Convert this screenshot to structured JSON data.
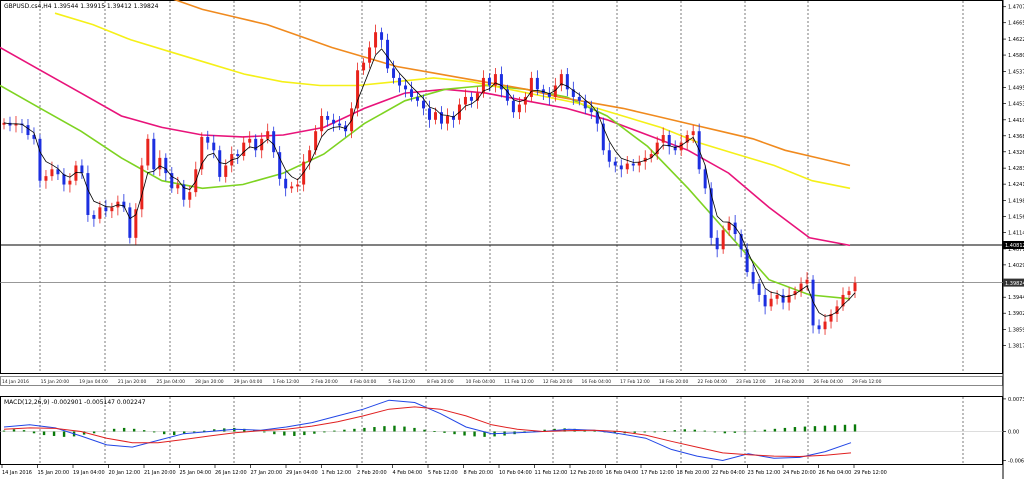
{
  "symbol_header": "GBPUSD.cs4,H4  1.39544 1.39915 1.39412 1.39824",
  "macd_header": "MACD(12,26,9) -0.002901 -0.005147 0.002247",
  "colors": {
    "bull": "#e8231c",
    "bear": "#1c2fe0",
    "ma_red": "#e8137a",
    "ma_green": "#7ed321",
    "ma_yellow": "#f5f018",
    "ma_orange": "#f08a1e",
    "ma_black": "#000000",
    "hist": "#0a7a0a",
    "macd_line": "#2246e6",
    "signal_line": "#e02020"
  },
  "chart_data": [
    {
      "type": "candlestick",
      "title": "GBPUSD.cs4,H4",
      "ylim": [
        1.3745,
        1.4722
      ],
      "price_labels": [
        "1.47070",
        "1.46650",
        "1.46220",
        "1.45800",
        "1.45370",
        "1.44950",
        "1.44530",
        "1.44100",
        "1.43680",
        "1.43260",
        "1.42830",
        "1.42410",
        "1.41980",
        "1.41560",
        "1.41140",
        "1.40710",
        "1.40290",
        "1.39440",
        "1.39020",
        "1.38590",
        "1.38170"
      ],
      "marked_prices": [
        "1.40812",
        "1.39824"
      ],
      "x_labels": [
        "14 Jan 2016",
        "15 Jan 20:00",
        "19 Jan 04:00",
        "20 Jan 12:00",
        "21 Jan 20:00",
        "25 Jan 04:00",
        "26 Jan 12:00",
        "27 Jan 20:00",
        "29 Jan 04:00",
        "1 Feb 12:00",
        "2 Feb 20:00",
        "4 Feb 04:00",
        "5 Feb 12:00",
        "8 Feb 20:00",
        "10 Feb 04:00",
        "11 Feb 12:00",
        "12 Feb 20:00",
        "16 Feb 04:00",
        "17 Feb 12:00",
        "18 Feb 20:00",
        "22 Feb 04:00",
        "23 Feb 12:00",
        "24 Feb 20:00",
        "26 Feb 04:00",
        "29 Feb 12:00"
      ],
      "mini_axis_labels": [
        "14 Jan 2016",
        "15 Jan 20:00",
        "19 Jan 04:00",
        "21 Jan 20:00",
        "25 Jan 04:00",
        "28 Jan 20:00",
        "29 Jan 04:00",
        "1 Feb 12:00",
        "2 Feb 20:00",
        "4 Feb 04:00",
        "5 Feb 12:00",
        "8 Feb 20:00",
        "10 Feb 04:00",
        "11 Feb 12:00",
        "12 Feb 20:00",
        "16 Feb 04:00",
        "17 Feb 12:00",
        "18 Feb 20:00",
        "22 Feb 04:00",
        "23 Feb 12:00",
        "24 Feb 20:00",
        "26 Feb 04:00",
        "29 Feb 12:00"
      ],
      "candles_close": [
        1.4402,
        1.4395,
        1.44,
        1.4396,
        1.437,
        1.436,
        1.425,
        1.4262,
        1.428,
        1.4267,
        1.424,
        1.425,
        1.429,
        1.427,
        1.416,
        1.415,
        1.418,
        1.417,
        1.418,
        1.4195,
        1.418,
        1.41,
        1.4175,
        1.429,
        1.436,
        1.428,
        1.431,
        1.427,
        1.423,
        1.424,
        1.42,
        1.422,
        1.428,
        1.4365,
        1.435,
        1.433,
        1.426,
        1.429,
        1.432,
        1.4315,
        1.435,
        1.436,
        1.433,
        1.436,
        1.438,
        1.4325,
        1.4255,
        1.423,
        1.4235,
        1.424,
        1.43,
        1.433,
        1.438,
        1.442,
        1.441,
        1.44,
        1.4395,
        1.438,
        1.444,
        1.454,
        1.456,
        1.46,
        1.464,
        1.462,
        1.4545,
        1.452,
        1.45,
        1.449,
        1.447,
        1.446,
        1.444,
        1.441,
        1.443,
        1.44,
        1.442,
        1.441,
        1.445,
        1.447,
        1.446,
        1.448,
        1.452,
        1.45,
        1.453,
        1.449,
        1.446,
        1.443,
        1.445,
        1.447,
        1.452,
        1.449,
        1.448,
        1.447,
        1.45,
        1.453,
        1.449,
        1.447,
        1.446,
        1.444,
        1.443,
        1.44,
        1.433,
        1.43,
        1.429,
        1.428,
        1.4295,
        1.429,
        1.43,
        1.431,
        1.432,
        1.435,
        1.437,
        1.434,
        1.433,
        1.435,
        1.437,
        1.438,
        1.428,
        1.423,
        1.41,
        1.407,
        1.412,
        1.414,
        1.411,
        1.407,
        1.401,
        1.398,
        1.395,
        1.392,
        1.394,
        1.395,
        1.393,
        1.395,
        1.396,
        1.398,
        1.399,
        1.387,
        1.386,
        1.388,
        1.39,
        1.392,
        1.395,
        1.396,
        1.3982
      ],
      "ma_series": [
        {
          "values": [
            1.46,
            1.454,
            1.448,
            1.442,
            1.439,
            1.437,
            1.4365,
            1.437,
            1.439,
            1.444,
            1.448,
            1.449,
            1.448,
            1.446,
            1.444,
            1.441,
            1.437,
            1.433,
            1.427,
            1.418,
            1.41,
            1.408
          ]
        },
        {
          "values": [
            1.45,
            1.444,
            1.438,
            1.431,
            1.425,
            1.423,
            1.424,
            1.427,
            1.432,
            1.44,
            1.446,
            1.449,
            1.45,
            1.449,
            1.447,
            1.442,
            1.434,
            1.423,
            1.411,
            1.399,
            1.395,
            1.394
          ]
        },
        {
          "values": [
            1.469,
            1.466,
            1.462,
            1.459,
            1.456,
            1.453,
            1.451,
            1.45,
            1.45,
            1.451,
            1.452,
            1.451,
            1.449,
            1.447,
            1.445,
            1.442,
            1.439,
            1.435,
            1.432,
            1.429,
            1.425,
            1.423
          ]
        },
        {
          "values": [
            1.473,
            1.47,
            1.468,
            1.466,
            1.463,
            1.46,
            1.4575,
            1.455,
            1.4535,
            1.452,
            1.4505,
            1.449,
            1.447,
            1.4455,
            1.444,
            1.442,
            1.44,
            1.438,
            1.436,
            1.433,
            1.431,
            1.429
          ]
        }
      ]
    },
    {
      "type": "histogram",
      "title": "MACD(12,26,9)",
      "ylim": [
        -0.0075,
        0.0075
      ],
      "y_labels": [
        "0.00730",
        "0.00",
        "-0.00647"
      ],
      "histogram": [
        0.0002,
        0.0005,
        0.0003,
        -0.0004,
        -0.0008,
        -0.001,
        -0.0012,
        -0.0011,
        -0.0007,
        -0.0004,
        0.0002,
        0.0006,
        0.0008,
        0.0006,
        0.0003,
        -0.0002,
        -0.0006,
        -0.0008,
        -0.0005,
        -0.0002,
        0.0002,
        0.0005,
        0.0007,
        0.0008,
        0.0006,
        0.0003,
        -0.0002,
        -0.0006,
        -0.0009,
        -0.001,
        -0.0008,
        -0.0005,
        -0.0002,
        0.0002,
        0.0004,
        0.0006,
        0.0008,
        0.001,
        0.0012,
        0.0013,
        0.0011,
        0.0008,
        0.0004,
        0.0001,
        -0.0003,
        -0.0006,
        -0.0009,
        -0.0011,
        -0.0012,
        -0.0011,
        -0.0009,
        -0.0006,
        -0.0003,
        0.0001,
        0.0004,
        0.0006,
        0.0007,
        0.0006,
        0.0004,
        0.0002,
        -0.0001,
        -0.0003,
        -0.0004,
        -0.0003,
        -0.0002,
        -0.0001,
        0.0001,
        0.0003,
        0.0005,
        0.0004,
        0.0002,
        -0.0002,
        -0.0004,
        -0.0003,
        -0.0001,
        0.0002,
        0.0004,
        0.0006,
        0.0008,
        0.001,
        0.0011,
        0.0012,
        0.0013,
        0.0014,
        0.0015,
        0.0016
      ],
      "macd": [
        0.001,
        0.0015,
        0.0008,
        -0.001,
        -0.003,
        -0.0035,
        -0.002,
        -0.0005,
        0.0,
        0.0005,
        0.0003,
        0.001,
        0.002,
        0.0035,
        0.005,
        0.007,
        0.0065,
        0.004,
        0.001,
        -0.0005,
        -0.0003,
        0.0,
        0.0005,
        0.0003,
        -0.0005,
        -0.0015,
        -0.004,
        -0.0055,
        -0.0065,
        -0.005,
        -0.006,
        -0.0058,
        -0.0045,
        -0.0025
      ],
      "signal": [
        0.0005,
        0.0008,
        0.0007,
        0.0,
        -0.0015,
        -0.0025,
        -0.0025,
        -0.0018,
        -0.001,
        -0.0003,
        0.0002,
        0.0005,
        0.0012,
        0.0022,
        0.0035,
        0.005,
        0.0055,
        0.005,
        0.0035,
        0.0015,
        0.0005,
        0.0,
        0.0002,
        0.0003,
        0.0,
        -0.0008,
        -0.0022,
        -0.0035,
        -0.0048,
        -0.0052,
        -0.0055,
        -0.0056,
        -0.0053,
        -0.0048
      ]
    }
  ]
}
